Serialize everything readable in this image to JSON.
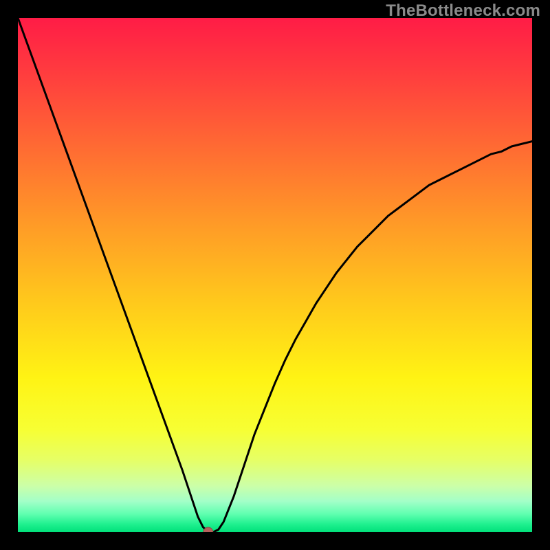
{
  "watermark": "TheBottleneck.com",
  "chart_data": {
    "type": "line",
    "title": "",
    "xlabel": "",
    "ylabel": "",
    "xlim": [
      0,
      100
    ],
    "ylim": [
      0,
      100
    ],
    "grid": false,
    "legend": false,
    "background": "rainbow-vertical-gradient red-yellow-green",
    "optimum_x": 37,
    "marker": {
      "x": 37,
      "y": 0,
      "color": "#b6615c",
      "radius_px": 7
    },
    "series": [
      {
        "name": "bottleneck-curve",
        "color": "#000000",
        "x": [
          0,
          2,
          4,
          6,
          8,
          10,
          12,
          14,
          16,
          18,
          20,
          22,
          24,
          26,
          28,
          30,
          32,
          33,
          34,
          35,
          36,
          37,
          38,
          39,
          40,
          42,
          44,
          46,
          48,
          50,
          52,
          54,
          56,
          58,
          60,
          62,
          64,
          66,
          68,
          70,
          72,
          74,
          76,
          78,
          80,
          82,
          84,
          86,
          88,
          90,
          92,
          94,
          96,
          98,
          100
        ],
        "y": [
          100,
          94.5,
          89,
          83.5,
          78,
          72.5,
          67,
          61.5,
          56,
          50.5,
          45,
          39.5,
          34,
          28.5,
          23,
          17.5,
          12,
          9,
          6,
          3,
          1,
          0,
          0,
          0.5,
          2,
          7,
          13,
          19,
          24,
          29,
          33.5,
          37.5,
          41,
          44.5,
          47.5,
          50.5,
          53,
          55.5,
          57.5,
          59.5,
          61.5,
          63,
          64.5,
          66,
          67.5,
          68.5,
          69.5,
          70.5,
          71.5,
          72.5,
          73.5,
          74,
          75,
          75.5,
          76
        ]
      }
    ],
    "gradient_stops": [
      {
        "offset": 0.0,
        "color": "#ff1c46"
      },
      {
        "offset": 0.1,
        "color": "#ff3a3f"
      },
      {
        "offset": 0.25,
        "color": "#ff6a33"
      },
      {
        "offset": 0.4,
        "color": "#ff9a27"
      },
      {
        "offset": 0.55,
        "color": "#ffc81c"
      },
      {
        "offset": 0.7,
        "color": "#fff314"
      },
      {
        "offset": 0.8,
        "color": "#f7ff33"
      },
      {
        "offset": 0.86,
        "color": "#e6ff66"
      },
      {
        "offset": 0.91,
        "color": "#ccffa8"
      },
      {
        "offset": 0.94,
        "color": "#a3ffc8"
      },
      {
        "offset": 0.965,
        "color": "#5fffb0"
      },
      {
        "offset": 0.985,
        "color": "#1ef08e"
      },
      {
        "offset": 1.0,
        "color": "#00e07a"
      }
    ]
  }
}
